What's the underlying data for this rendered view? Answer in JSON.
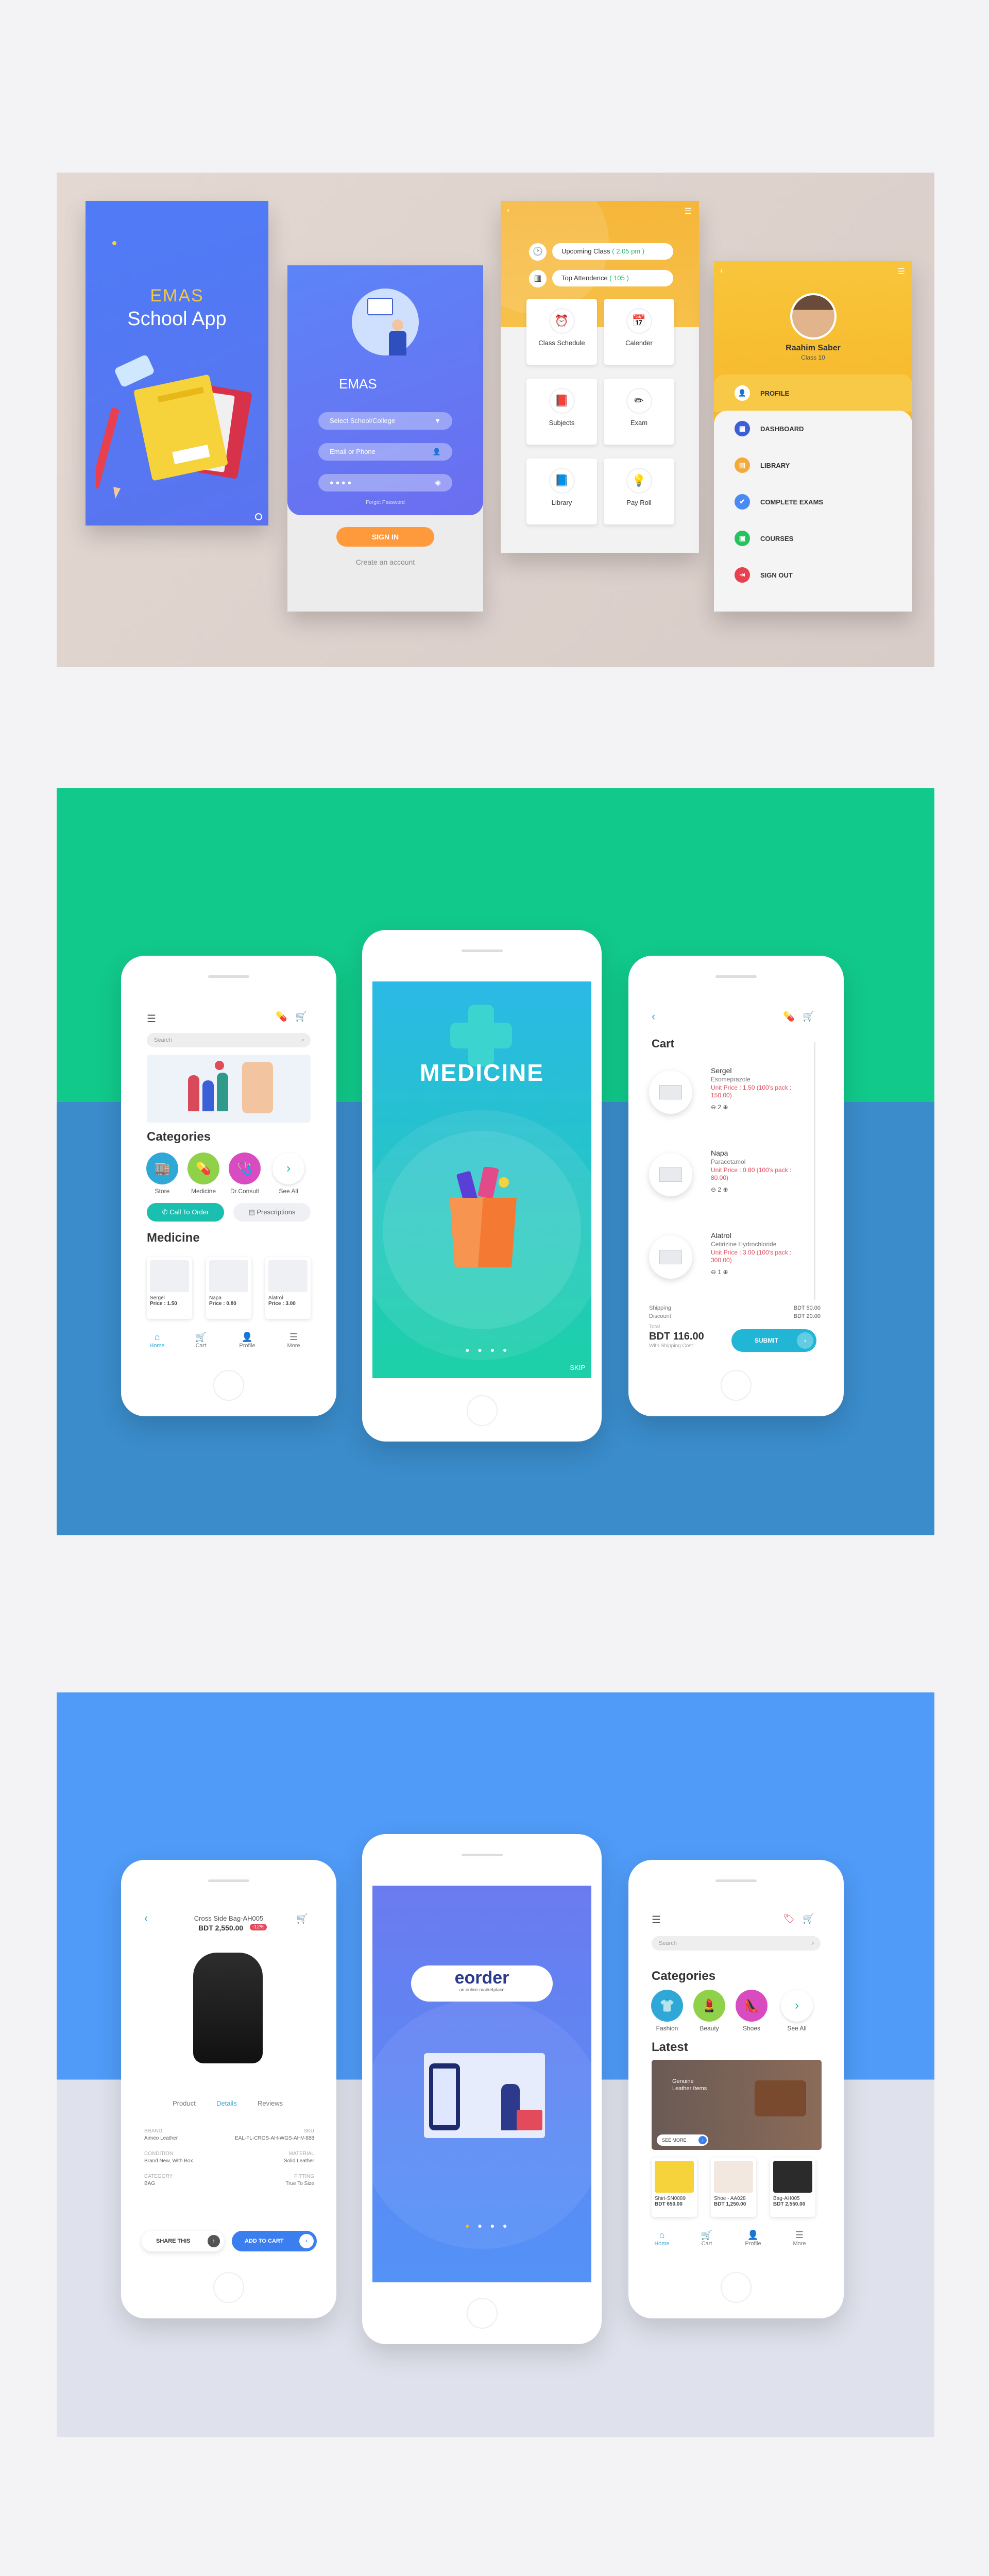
{
  "school": {
    "splash_title": "EMAS",
    "splash_subtitle": "School App",
    "login_logo": "EMAS",
    "login_select_placeholder": "Select School/College",
    "login_email_placeholder": "Email or Phone",
    "login_password_mask": "● ● ● ●",
    "login_forgot": "Forgot Password",
    "login_signin": "SIGN IN",
    "login_create": "Create an account",
    "dash_upcoming": "Upcoming Class",
    "dash_upcoming_time": "( 2.05 pm )",
    "dash_attendance": "Top Attendence",
    "dash_attendance_val": "( 105 )",
    "tiles": [
      {
        "label": "Class Schedule",
        "icon": "⏰",
        "color": "#1bb5a8"
      },
      {
        "label": "Calender",
        "icon": "📅",
        "color": "#4a8af4"
      },
      {
        "label": "Subjects",
        "icon": "📕",
        "color": "#5a6fd6"
      },
      {
        "label": "Exam",
        "icon": "✏",
        "color": "#f4b53b"
      },
      {
        "label": "Library",
        "icon": "📘",
        "color": "#3b6fd8"
      },
      {
        "label": "Pay Roll",
        "icon": "💡",
        "color": "#f0b43a"
      }
    ],
    "profile_name": "Raahim Saber",
    "profile_class": "Class 10",
    "menu": [
      {
        "label": "PROFILE",
        "icon": "👤",
        "color": "#f4a93b"
      },
      {
        "label": "DASHBOARD",
        "icon": "▦",
        "color": "#3a5fd6"
      },
      {
        "label": "LIBRARY",
        "icon": "▤",
        "color": "#f4a93b"
      },
      {
        "label": "COMPLETE EXAMS",
        "icon": "✔",
        "color": "#4a8af4"
      },
      {
        "label": "COURSES",
        "icon": "▣",
        "color": "#27c25f"
      },
      {
        "label": "SIGN OUT",
        "icon": "⇥",
        "color": "#e8404f"
      }
    ]
  },
  "medicine": {
    "search_placeholder": "Search",
    "categories_title": "Categories",
    "categories": [
      {
        "label": "Store",
        "color": "#2fa8d8",
        "icon": "🏬"
      },
      {
        "label": "Medicine",
        "color": "#8fd24a",
        "icon": "💊"
      },
      {
        "label": "Dr.Consult",
        "color": "#d94bc0",
        "icon": "🩺"
      },
      {
        "label": "See All",
        "color": "#ffffff",
        "icon": "›"
      }
    ],
    "call_btn": "Call To Order",
    "presc_btn": "Prescriptions",
    "medicine_title": "Medicine",
    "products": [
      {
        "name": "Sergel",
        "price": "Price : 1.50"
      },
      {
        "name": "Napa",
        "price": "Price : 0.80"
      },
      {
        "name": "Alatrol",
        "price": "Price : 3.00"
      }
    ],
    "tabs": [
      "Home",
      "Cart",
      "Profile",
      "More"
    ],
    "splash_title": "MEDICINE",
    "skip": "SKIP",
    "cart_title": "Cart",
    "cart_items": [
      {
        "name": "Sergel",
        "generic": "Esomeprazole",
        "price": "Unit Price : 1.50 (100's pack : 150.00)",
        "qty": "2"
      },
      {
        "name": "Napa",
        "generic": "Paracetamol",
        "price": "Unit Price : 0.80 (100's pack : 80.00)",
        "qty": "2"
      },
      {
        "name": "Alatrol",
        "generic": "Cetirizine Hydrochloride",
        "price": "Unit Price : 3.00 (100's pack : 300.00)",
        "qty": "1"
      }
    ],
    "shipping_label": "Shipping",
    "shipping_val": "BDT 50.00",
    "discount_label": "Discount",
    "discount_val": "BDT 20.00",
    "total_label": "Total",
    "total_val": "BDT 116.00",
    "total_note": "With Shipping Cost",
    "submit": "SUBMIT"
  },
  "eorder": {
    "product_title": "Cross Side Bag-AH005",
    "product_price": "BDT 2,550.00",
    "product_badge": "-12%",
    "detail_tabs": [
      "Product",
      "Details",
      "Reviews"
    ],
    "details": [
      {
        "k": "BRAND",
        "v": "Aimeo Leather",
        "k2": "SKU",
        "v2": "EAL-FL-CROS-AH-WGS-AHV-888"
      },
      {
        "k": "CONDITION",
        "v": "Brand New, With Box",
        "k2": "MATERIAL",
        "v2": "Solid Leather"
      },
      {
        "k": "CATEGORY",
        "v": "BAG",
        "k2": "FITTING",
        "v2": "True To Size"
      }
    ],
    "share": "SHARE THIS",
    "add_cart": "ADD TO CART",
    "logo": "eorder",
    "logo_sub": "an online marketplace",
    "search_placeholder": "Search",
    "categories_title": "Categories",
    "categories": [
      {
        "label": "Fashion",
        "color": "#2fa8d8",
        "icon": "👕"
      },
      {
        "label": "Beauty",
        "color": "#8fd24a",
        "icon": "💄"
      },
      {
        "label": "Shoes",
        "color": "#d94bc0",
        "icon": "👠"
      },
      {
        "label": "See All",
        "color": "#ffffff",
        "icon": "›"
      }
    ],
    "latest_title": "Latest",
    "banner_text": "Genuine Leather Items",
    "banner_btn": "SEE MORE",
    "products": [
      {
        "name": "Shirt-SN0089",
        "price": "BDT 650.00"
      },
      {
        "name": "Shoe - AA028",
        "price": "BDT 1,250.00"
      },
      {
        "name": "Bag-AH005",
        "price": "BDT 2,550.00"
      }
    ],
    "tabs": [
      "Home",
      "Cart",
      "Profile",
      "More"
    ]
  }
}
